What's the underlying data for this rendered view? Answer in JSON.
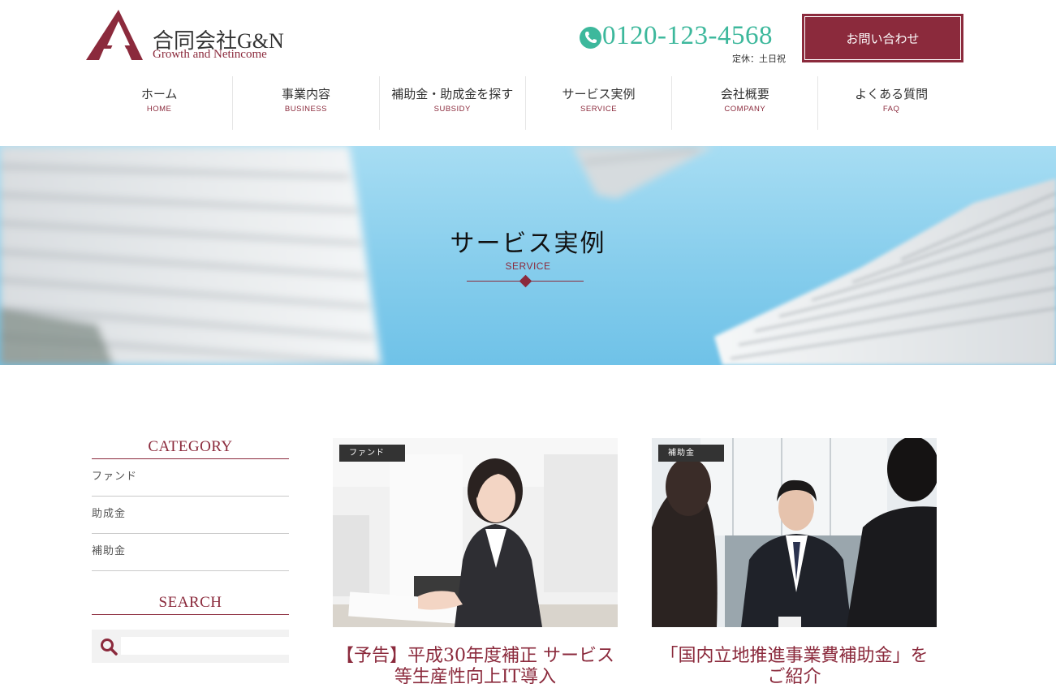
{
  "brand": {
    "name": "合同会社G&N",
    "tagline": "Growth and Netincome"
  },
  "contact": {
    "phone": "0120-123-4568",
    "note": "定休：土日祝",
    "button_label": "お問い合わせ"
  },
  "nav": [
    {
      "label": "ホーム",
      "en": "HOME"
    },
    {
      "label": "事業内容",
      "en": "BUSINESS"
    },
    {
      "label": "補助金・助成金を探す",
      "en": "SUBSIDY"
    },
    {
      "label": "サービス実例",
      "en": "SERVICE"
    },
    {
      "label": "会社概要",
      "en": "COMPANY"
    },
    {
      "label": "よくある質問",
      "en": "FAQ"
    }
  ],
  "hero": {
    "title": "サービス実例",
    "subtitle": "SERVICE"
  },
  "sidebar": {
    "category_heading": "CATEGORY",
    "categories": [
      "ファンド",
      "助成金",
      "補助金"
    ],
    "search_heading": "SEARCH",
    "search_value": ""
  },
  "posts": [
    {
      "tag": "ファンド",
      "title": "【予告】平成30年度補正 サービス等生産性向上IT導入"
    },
    {
      "tag": "補助金",
      "title": "「国内立地推進事業費補助金」をご紹介"
    }
  ],
  "colors": {
    "brand": "#8b2a3c",
    "phone": "#3db89c",
    "sky": "#86cdec"
  }
}
